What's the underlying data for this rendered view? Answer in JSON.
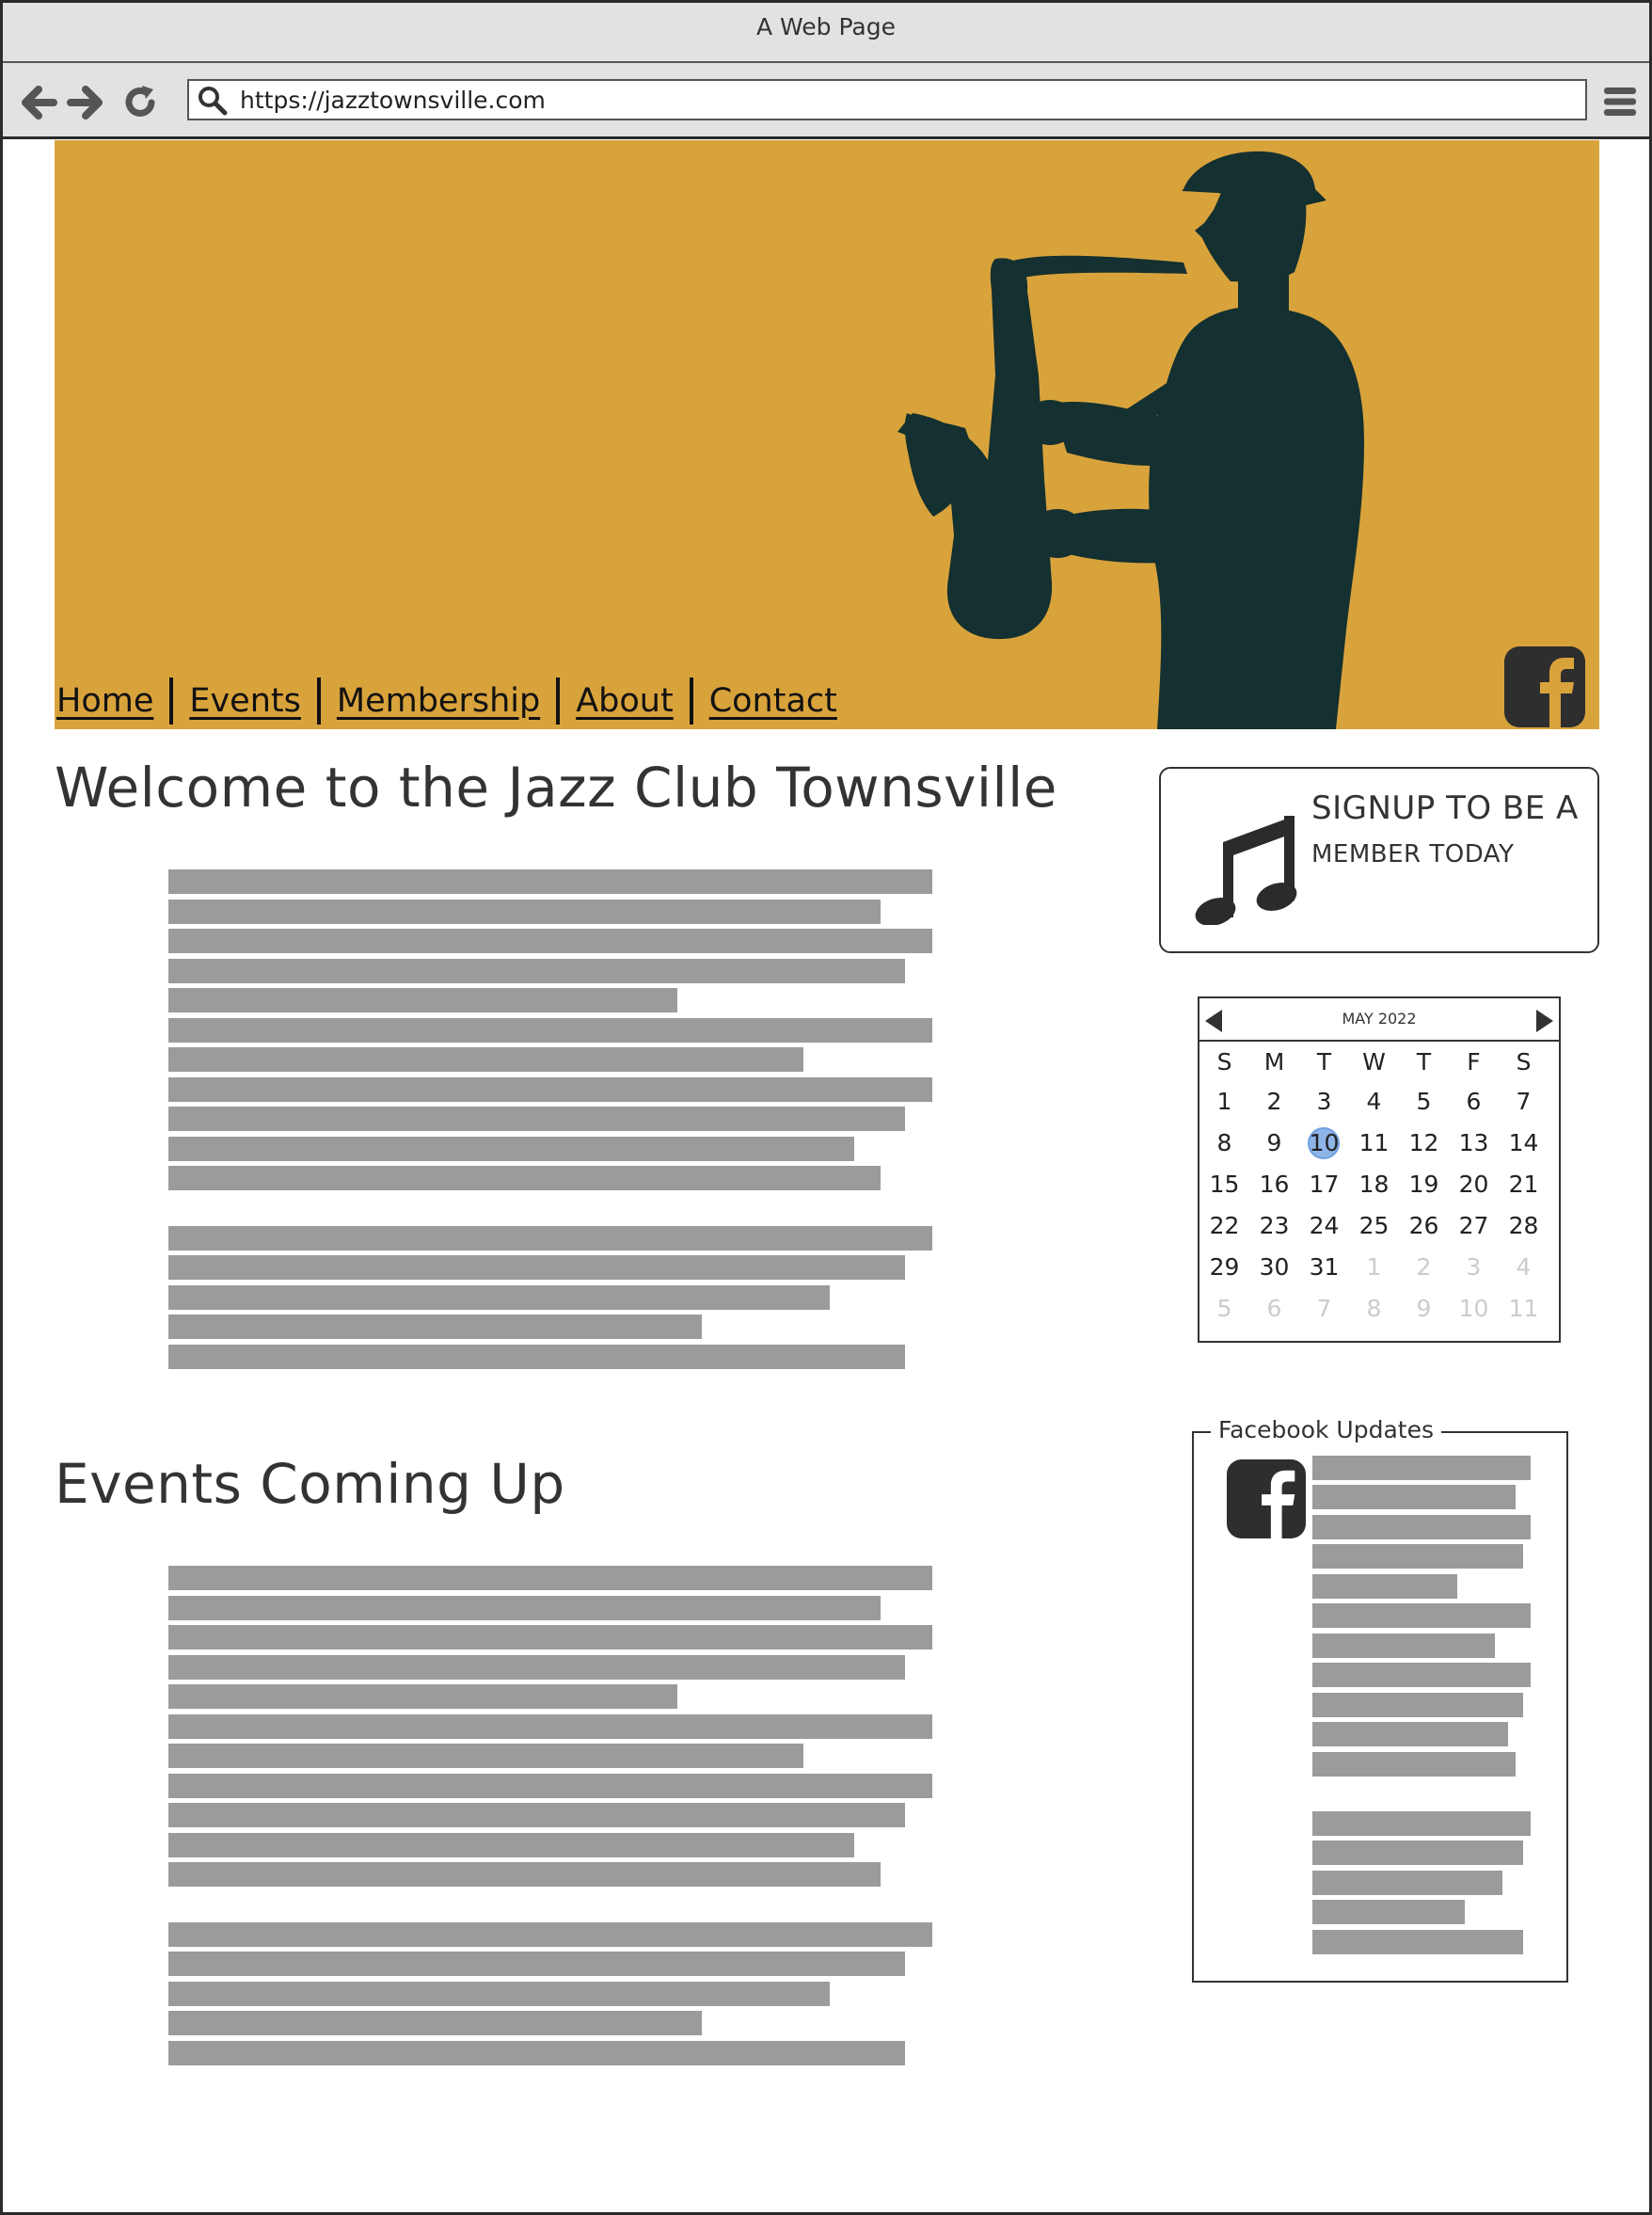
{
  "browser": {
    "window_title": "A Web Page",
    "url": "https://jazztownsville.com"
  },
  "nav": {
    "items": [
      "Home",
      "Events",
      "Membership",
      "About",
      "Contact"
    ]
  },
  "colors": {
    "banner": "#d9a33c",
    "silhouette": "#143030",
    "placeholder_bar": "#9b9b9b",
    "selected_day": "#8fb4e8"
  },
  "icons": [
    "back-arrow-icon",
    "forward-arrow-icon",
    "reload-icon",
    "search-icon",
    "hamburger-menu-icon",
    "facebook-icon",
    "music-note-icon",
    "prev-month-icon",
    "next-month-icon"
  ],
  "main": {
    "welcome_heading": "Welcome to the Jazz Club Townsville",
    "events_heading": "Events Coming Up"
  },
  "signup": {
    "line1": "SIGNUP TO BE A",
    "line2": "MEMBER TODAY"
  },
  "calendar": {
    "month_label": "MAY 2022",
    "weekdays": [
      "S",
      "M",
      "T",
      "W",
      "T",
      "F",
      "S"
    ],
    "weeks": [
      [
        "1",
        "2",
        "3",
        "4",
        "5",
        "6",
        "7"
      ],
      [
        "8",
        "9",
        "10",
        "11",
        "12",
        "13",
        "14"
      ],
      [
        "15",
        "16",
        "17",
        "18",
        "19",
        "20",
        "21"
      ],
      [
        "22",
        "23",
        "24",
        "25",
        "26",
        "27",
        "28"
      ],
      [
        "29",
        "30",
        "31",
        "1",
        "2",
        "3",
        "4"
      ],
      [
        "5",
        "6",
        "7",
        "8",
        "9",
        "10",
        "11"
      ]
    ],
    "selected_day": "10"
  },
  "facebook_updates": {
    "title": "Facebook Updates"
  }
}
